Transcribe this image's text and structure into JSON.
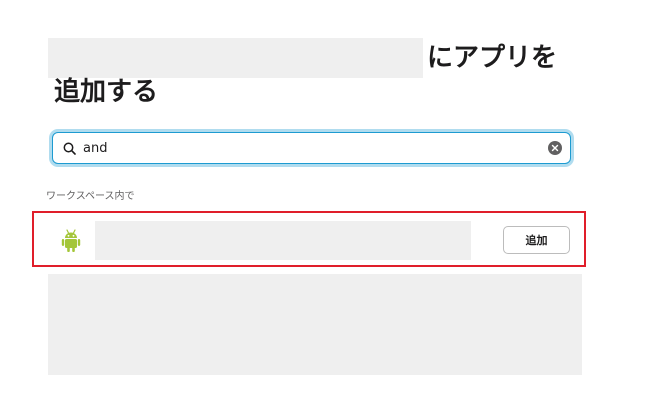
{
  "dialog": {
    "title_line1": "にアプリを",
    "title_line2": "追加する"
  },
  "search": {
    "value": "and",
    "icon": "search-icon",
    "clear_icon": "clear-icon"
  },
  "results": {
    "section_label": "ワークスペース内で",
    "items": [
      {
        "icon": "android-icon",
        "icon_color": "#a4c639",
        "add_label": "追加"
      }
    ]
  },
  "colors": {
    "focus_border": "#1d9bd1",
    "highlight_border": "#e01e2a",
    "redacted": "#efefef"
  }
}
